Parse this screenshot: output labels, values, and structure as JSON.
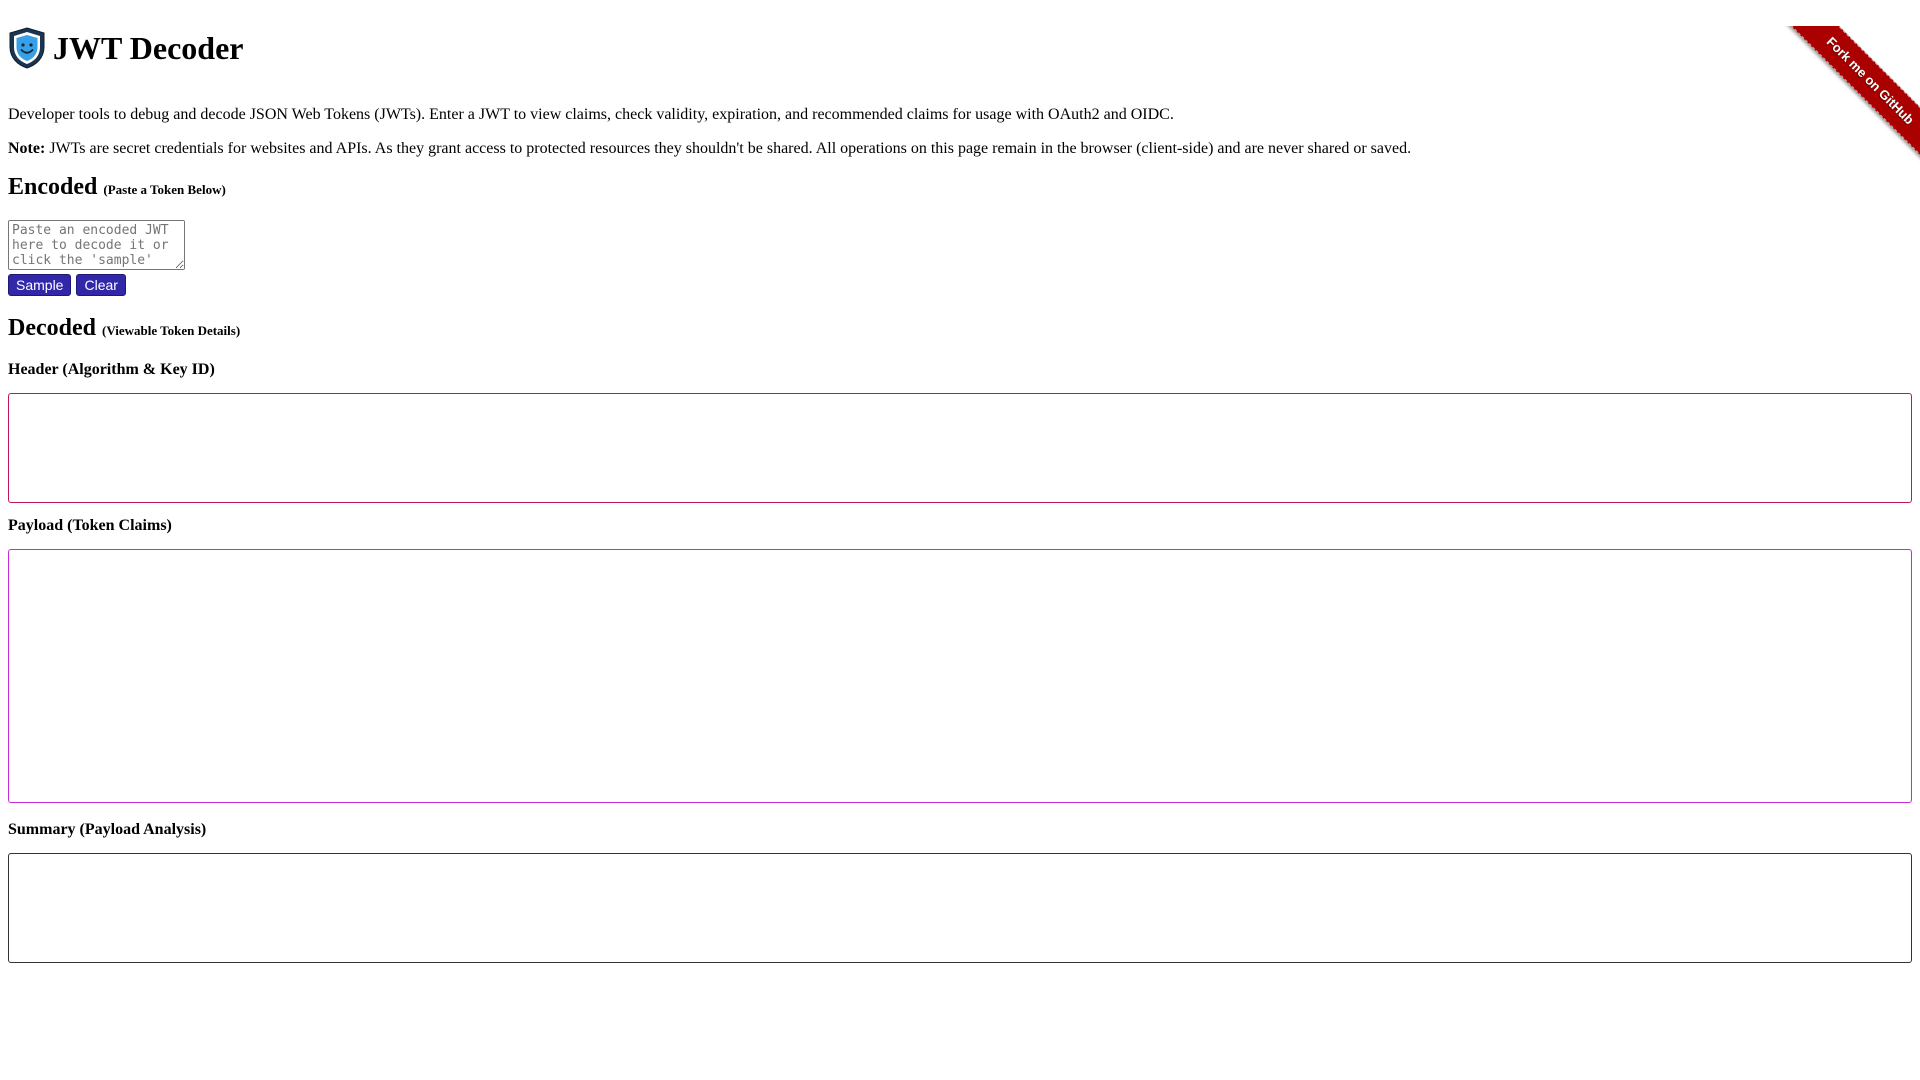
{
  "header": {
    "title": "JWT Decoder",
    "logo_icon": "shield-smile-icon"
  },
  "intro": {
    "text": "Developer tools to debug and decode JSON Web Tokens (JWTs). Enter a JWT to view claims, check validity, expiration, and recommended claims for usage with OAuth2 and OIDC."
  },
  "note": {
    "label": "Note:",
    "text": " JWTs are secret credentials for websites and APIs. As they grant access to protected resources they shouldn't be shared. All operations on this page remain in the browser (client-side) and are never shared or saved."
  },
  "encoded": {
    "heading": "Encoded",
    "subheading": "(Paste a Token Below)",
    "placeholder": "Paste an encoded JWT here to decode it or click the 'sample' button",
    "value": "",
    "sample_label": "Sample",
    "clear_label": "Clear"
  },
  "decoded": {
    "heading": "Decoded",
    "subheading": "(Viewable Token Details)",
    "header_label": "Header (Algorithm & Key ID)",
    "payload_label": "Payload (Token Claims)",
    "summary_label": "Summary (Payload Analysis)"
  },
  "ribbon": {
    "label": "Fork me on GitHub",
    "color": "#aa0000"
  },
  "colors": {
    "button": "#3127a8",
    "header_border": "#c2185b",
    "payload_border": "#c42ad4",
    "summary_border": "#333333"
  }
}
